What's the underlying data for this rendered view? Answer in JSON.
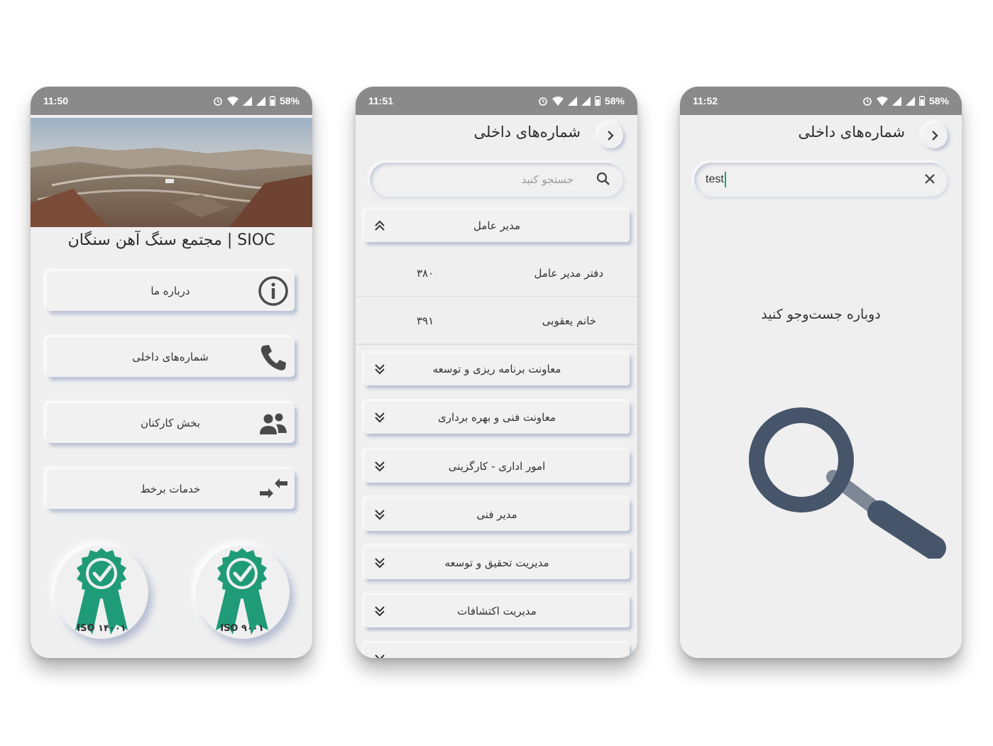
{
  "phones": [
    {
      "status": {
        "time": "11:50",
        "battery": "58%"
      },
      "app_title": "مجتمع سنگ آهن سنگان | SIOC",
      "menu": [
        {
          "label": "درباره ما",
          "icon": "info-icon"
        },
        {
          "label": "شماره‌های داخلی",
          "icon": "phone-icon"
        },
        {
          "label": "بخش کارکنان",
          "icon": "people-icon"
        },
        {
          "label": "خدمات برخط",
          "icon": "swap-arrows-icon"
        }
      ],
      "badges": [
        {
          "label": "ISO ۱۴۰۰۱",
          "icon": "certified-ribbon-icon",
          "color": "#1f9b78"
        },
        {
          "label": "ISO ۹۰۰۱",
          "icon": "certified-ribbon-icon",
          "color": "#1f9b78"
        }
      ]
    },
    {
      "status": {
        "time": "11:51",
        "battery": "58%"
      },
      "header": {
        "title": "شماره‌های داخلی"
      },
      "search": {
        "placeholder": "جستجو کنید"
      },
      "sections": [
        {
          "title": "مدیر عامل",
          "expanded": true,
          "rows": [
            {
              "name": "دفتر مدیر عامل",
              "number": "۳۸۰"
            },
            {
              "name": "خانم یعقوبی",
              "number": "۳۹۱"
            }
          ]
        },
        {
          "title": "معاونت برنامه ریزی و توسعه",
          "expanded": false
        },
        {
          "title": "معاونت فنی و بهره برداری",
          "expanded": false
        },
        {
          "title": "امور اداری - کارگزینی",
          "expanded": false
        },
        {
          "title": "مدیر فنی",
          "expanded": false
        },
        {
          "title": "مدیریت تحقیق و توسعه",
          "expanded": false
        },
        {
          "title": "مدیریت اکتشافات",
          "expanded": false
        }
      ]
    },
    {
      "status": {
        "time": "11:52",
        "battery": "58%"
      },
      "header": {
        "title": "شماره‌های داخلی"
      },
      "search": {
        "value": "test"
      },
      "empty_message": "دوباره جست‌وجو کنید",
      "illustration": {
        "icon": "magnifier-illustration",
        "color": "#46556a"
      }
    }
  ],
  "colors": {
    "statusbar": "#8a8a8a",
    "background": "#efefef",
    "accent": "#1f9b78",
    "caret": "#1aa27a"
  }
}
